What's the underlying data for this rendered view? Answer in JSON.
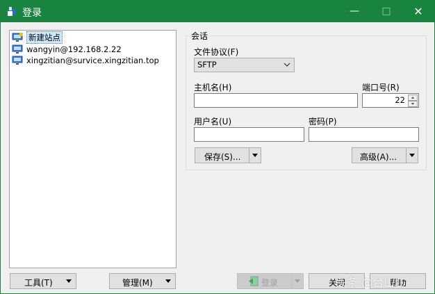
{
  "window": {
    "title": "登录",
    "controls": {
      "minimize": "—",
      "maximize": "□",
      "close": "✕"
    },
    "accent_color": "#18843f"
  },
  "site_tree": {
    "items": [
      {
        "label": "新建站点",
        "icon": "new-site-monitor-icon",
        "selected": true
      },
      {
        "label": "wangyin@192.168.2.22",
        "icon": "monitor-icon",
        "selected": false
      },
      {
        "label": "xingzitian@survice.xingzitian.top",
        "icon": "monitor-icon",
        "selected": false
      }
    ]
  },
  "session": {
    "group_label": "会话",
    "protocol_label": "文件协议(F)",
    "protocol_value": "SFTP",
    "host_label": "主机名(H)",
    "host_value": "",
    "port_label": "端口号(R)",
    "port_value": "22",
    "user_label": "用户名(U)",
    "user_value": "",
    "password_label": "密码(P)",
    "password_value": "",
    "save_button": "保存(S)...",
    "advanced_button": "高级(A)..."
  },
  "footer": {
    "tools_button": "工具(T)",
    "manage_button": "管理(M)",
    "login_button": "登录",
    "close_button": "关闭",
    "help_button": "帮助"
  },
  "watermark": "头条 @台山IT"
}
